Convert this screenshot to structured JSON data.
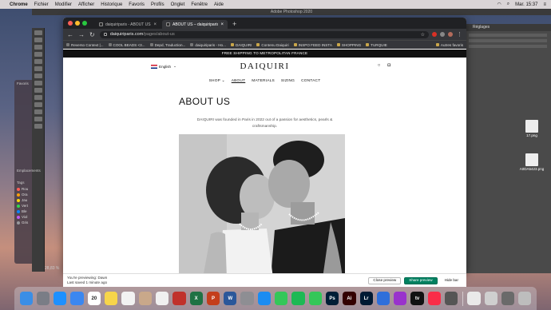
{
  "menubar": {
    "app": "Chrome",
    "items": [
      "Fichier",
      "Modifier",
      "Afficher",
      "Historique",
      "Favoris",
      "Profils",
      "Onglet",
      "Fenêtre",
      "Aide"
    ],
    "clock": "Mar. 15:37"
  },
  "photoshop": {
    "title": "Adobe Photoshop 2020",
    "panel_header": "Réglages",
    "zoom": "28,83 %"
  },
  "finder": {
    "favorites_label": "Favoris",
    "locations_label": "Emplacements",
    "tags_label": "Tags",
    "tags": [
      {
        "label": "Rou",
        "color": "#ff5f57"
      },
      {
        "label": "Ora",
        "color": "#ff9f0a"
      },
      {
        "label": "Jau",
        "color": "#ffd60a"
      },
      {
        "label": "Vert",
        "color": "#32d74b"
      },
      {
        "label": "Ble",
        "color": "#0a84ff"
      },
      {
        "label": "Viol",
        "color": "#bf5af2"
      },
      {
        "label": "Gris",
        "color": "#98989d"
      }
    ]
  },
  "desktop_files": [
    "17.png",
    "A0DA5423.png"
  ],
  "chrome": {
    "tabs": [
      {
        "label": "daiquiriparis - ABOUT US · Sh",
        "active": false
      },
      {
        "label": "ABOUT US – daiquiriparis",
        "active": true
      }
    ],
    "url_host": "daiquiriparis.com",
    "url_path": "/pages/about-us",
    "bookmarks": [
      {
        "label": "Reverso Context |...",
        "folder": false
      },
      {
        "label": "COOL BEADS <3...",
        "folder": false
      },
      {
        "label": "Depd, Traduction...",
        "folder": false
      },
      {
        "label": "daiquiriparis - Ho...",
        "folder": false
      },
      {
        "label": "DAIQUIRI",
        "folder": true
      },
      {
        "label": "Contenu Daiquiri",
        "folder": true
      },
      {
        "label": "INSPO FEED INSTA",
        "folder": true
      },
      {
        "label": "SHOPPING",
        "folder": true
      },
      {
        "label": "TURQUIE",
        "folder": true
      }
    ],
    "other_bookmarks": "Autres favoris"
  },
  "page": {
    "announcement": "FREE SHIPPING TO METROPOLITAN FRANCE",
    "language": "English",
    "logo": "DAIQUIRI",
    "nav": [
      {
        "label": "SHOP ⌄",
        "active": false
      },
      {
        "label": "ABOUT",
        "active": true
      },
      {
        "label": "MATERIALS",
        "active": false
      },
      {
        "label": "SIZING",
        "active": false
      },
      {
        "label": "CONTACT",
        "active": false
      }
    ],
    "title": "ABOUT US",
    "intro": "DAIQUIRI was founded in Paris in 2022 out of a passion for aesthetics, pearls & craftsmanship."
  },
  "preview_bar": {
    "line1": "You're previewing: Dawn",
    "line2": "Last saved 1 minute ago",
    "close": "Close preview",
    "share": "Share preview",
    "hide": "Hide bar"
  },
  "dock": {
    "apps": [
      {
        "name": "finder",
        "color": "#3a8ee6",
        "text": ""
      },
      {
        "name": "launchpad",
        "color": "#7a7d86",
        "text": ""
      },
      {
        "name": "safari",
        "color": "#1e90ff",
        "text": ""
      },
      {
        "name": "mail",
        "color": "#3b87f0",
        "text": ""
      },
      {
        "name": "calendar",
        "color": "#ffffff",
        "text": "20"
      },
      {
        "name": "notes",
        "color": "#f7d54a",
        "text": ""
      },
      {
        "name": "chrome",
        "color": "#f2f2f2",
        "text": ""
      },
      {
        "name": "contacts",
        "color": "#c9a88a",
        "text": ""
      },
      {
        "name": "photos",
        "color": "#f0f0f0",
        "text": ""
      },
      {
        "name": "photo-booth",
        "color": "#c0312b",
        "text": ""
      },
      {
        "name": "excel",
        "color": "#1f7244",
        "text": "X"
      },
      {
        "name": "powerpoint",
        "color": "#c43e1c",
        "text": "P"
      },
      {
        "name": "word",
        "color": "#2b579a",
        "text": "W"
      },
      {
        "name": "preferences",
        "color": "#8e8e93",
        "text": ""
      },
      {
        "name": "app-store",
        "color": "#1b8cf2",
        "text": ""
      },
      {
        "name": "messages",
        "color": "#34c759",
        "text": ""
      },
      {
        "name": "spotify",
        "color": "#1db954",
        "text": ""
      },
      {
        "name": "facetime",
        "color": "#34c759",
        "text": ""
      },
      {
        "name": "photoshop",
        "color": "#001e36",
        "text": "Ps"
      },
      {
        "name": "illustrator",
        "color": "#330000",
        "text": "Ai"
      },
      {
        "name": "lightroom",
        "color": "#001a33",
        "text": "Lr"
      },
      {
        "name": "keynote",
        "color": "#2f6fda",
        "text": ""
      },
      {
        "name": "podcasts",
        "color": "#9933cc",
        "text": ""
      },
      {
        "name": "tv",
        "color": "#111111",
        "text": "tv"
      },
      {
        "name": "music",
        "color": "#fa2d48",
        "text": ""
      },
      {
        "name": "bluetooth-screen",
        "color": "#555",
        "text": ""
      }
    ],
    "trailing": [
      {
        "name": "preview-doc",
        "color": "#e9e9e9",
        "text": ""
      },
      {
        "name": "image-doc",
        "color": "#cfcfcf",
        "text": ""
      },
      {
        "name": "downloads",
        "color": "#6a6a6a",
        "text": ""
      },
      {
        "name": "trash",
        "color": "#bdbdbd",
        "text": ""
      }
    ]
  }
}
